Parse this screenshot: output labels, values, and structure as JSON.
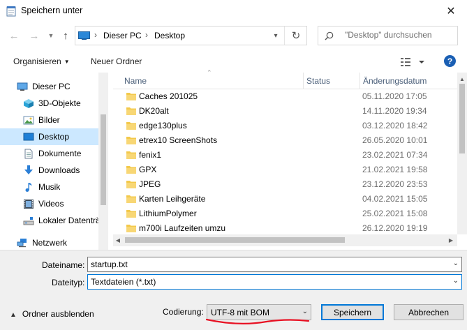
{
  "window": {
    "title": "Speichern unter",
    "close_icon": "close-icon"
  },
  "navigation": {
    "back_icon": "arrow-left-icon",
    "forward_icon": "arrow-right-icon",
    "recent_icon": "chevron-down-icon",
    "up_icon": "arrow-up-icon",
    "breadcrumb": [
      "Dieser PC",
      "Desktop"
    ],
    "refresh_icon": "refresh-icon",
    "search_placeholder": "\"Desktop\" durchsuchen"
  },
  "toolbar": {
    "organize_label": "Organisieren",
    "new_folder_label": "Neuer Ordner",
    "view_icon": "view-options-icon",
    "help_label": "?"
  },
  "sidebar": {
    "items": [
      {
        "label": "Dieser PC",
        "icon": "computer-icon",
        "selected": false
      },
      {
        "label": "3D-Objekte",
        "icon": "cube-icon",
        "selected": false
      },
      {
        "label": "Bilder",
        "icon": "pictures-icon",
        "selected": false
      },
      {
        "label": "Desktop",
        "icon": "desktop-icon",
        "selected": true
      },
      {
        "label": "Dokumente",
        "icon": "documents-icon",
        "selected": false
      },
      {
        "label": "Downloads",
        "icon": "download-icon",
        "selected": false
      },
      {
        "label": "Musik",
        "icon": "music-icon",
        "selected": false
      },
      {
        "label": "Videos",
        "icon": "videos-icon",
        "selected": false
      },
      {
        "label": "Lokaler Datenträ",
        "icon": "drive-icon",
        "selected": false
      },
      {
        "label": "Netzwerk",
        "icon": "network-icon",
        "selected": false
      }
    ]
  },
  "file_list": {
    "columns": {
      "name": "Name",
      "status": "Status",
      "modified": "Änderungsdatum"
    },
    "rows": [
      {
        "name": "Caches 201025",
        "modified": "05.11.2020 17:05"
      },
      {
        "name": "DK20alt",
        "modified": "14.11.2020 19:34"
      },
      {
        "name": "edge130plus",
        "modified": "03.12.2020 18:42"
      },
      {
        "name": "etrex10 ScreenShots",
        "modified": "26.05.2020 10:01"
      },
      {
        "name": "fenix1",
        "modified": "23.02.2021 07:34"
      },
      {
        "name": "GPX",
        "modified": "21.02.2021 19:58"
      },
      {
        "name": "JPEG",
        "modified": "23.12.2020 23:53"
      },
      {
        "name": "Karten Leihgeräte",
        "modified": "04.02.2021 15:05"
      },
      {
        "name": "LithiumPolymer",
        "modified": "25.02.2021 15:08"
      },
      {
        "name": "m700i Laufzeiten umzu",
        "modified": "26.12.2020 19:19"
      }
    ]
  },
  "form": {
    "filename_label": "Dateiname:",
    "filename_value": "startup.txt",
    "filetype_label": "Dateityp:",
    "filetype_value": "Textdateien (*.txt)",
    "hide_folders_label": "Ordner ausblenden",
    "encoding_label": "Codierung:",
    "encoding_value": "UTF-8 mit BOM",
    "save_label": "Speichern",
    "cancel_label": "Abbrechen"
  },
  "colors": {
    "selection": "#cce8ff",
    "accent": "#0078d7",
    "folder": "#f3c94b",
    "annotation_underline": "#e81123"
  }
}
